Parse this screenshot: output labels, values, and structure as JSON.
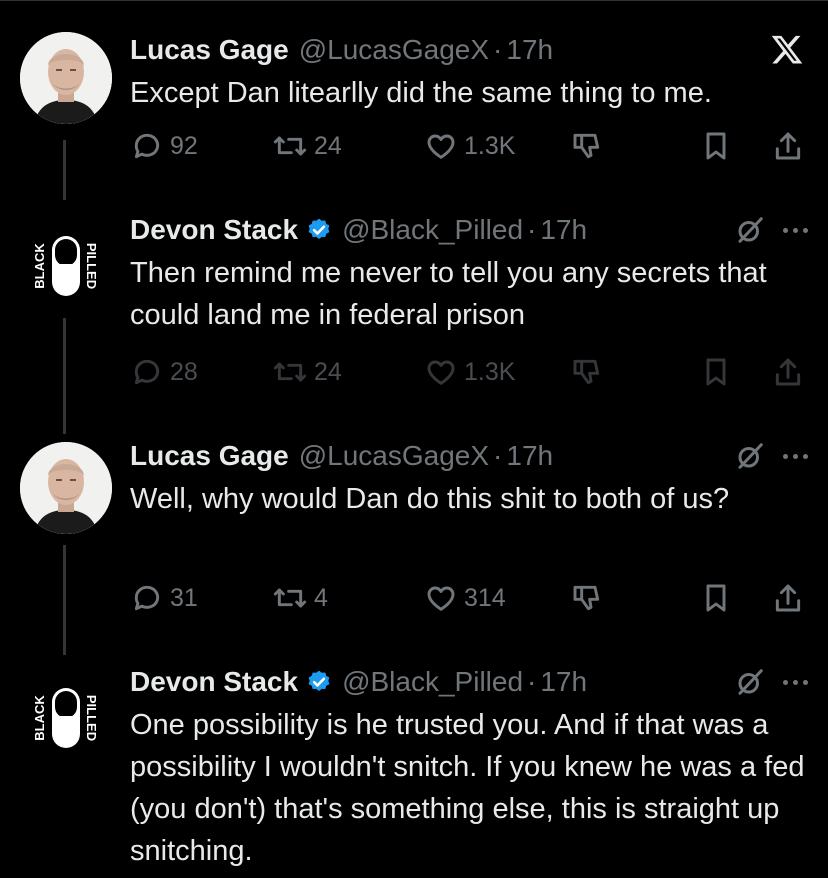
{
  "tweets": [
    {
      "name": "Lucas Gage",
      "handle": "@LucasGageX",
      "time": "17h",
      "verified": false,
      "text": "Except Dan litearlly did the same thing to me.",
      "replies": "92",
      "retweets": "24",
      "likes": "1.3K",
      "header_icon": "x-logo-icon"
    },
    {
      "name": "Devon Stack",
      "handle": "@Black_Pilled",
      "time": "17h",
      "verified": true,
      "text": "Then remind me never to tell you any secrets that could land me in federal prison",
      "replies": "28",
      "retweets": "24",
      "likes": "1.3K",
      "header_icon": "grok-icon"
    },
    {
      "name": "Lucas Gage",
      "handle": "@LucasGageX",
      "time": "17h",
      "verified": false,
      "text": "Well, why would Dan do this shit to both of us?",
      "replies": "31",
      "retweets": "4",
      "likes": "314",
      "header_icon": "grok-icon"
    },
    {
      "name": "Devon Stack",
      "handle": "@Black_Pilled",
      "time": "17h",
      "verified": true,
      "text": "One possibility is he trusted you. And if that was a possibility I wouldn't snitch. If you knew he was a fed (you don't) that's something else, this is straight up snitching.",
      "header_icon": "grok-icon"
    }
  ],
  "logo": {
    "left_word": "BLACK",
    "right_word": "PILLED"
  },
  "colors": {
    "background": "#000000",
    "text": "#e7e9ea",
    "muted": "#71767b",
    "verified": "#1d9bf0"
  }
}
